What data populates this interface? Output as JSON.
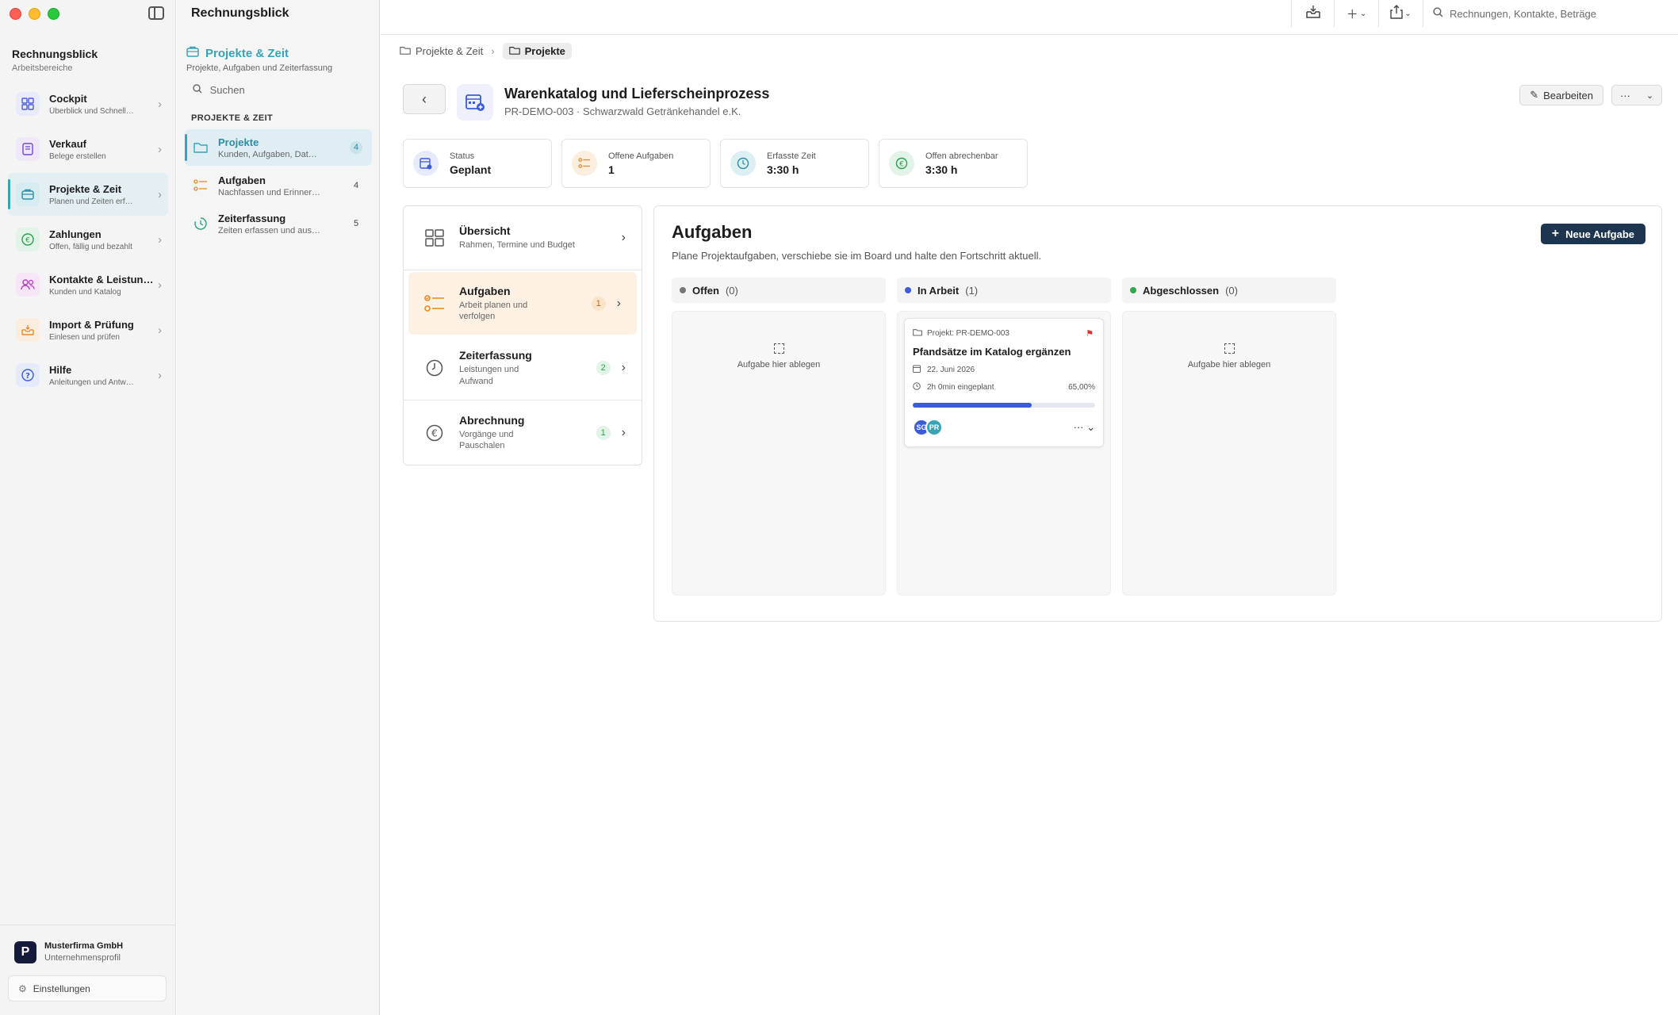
{
  "app": {
    "title": "Rechnungsblick"
  },
  "sidebar": {
    "title": "Rechnungsblick",
    "subtitle": "Arbeitsbereiche",
    "items": [
      {
        "label": "Cockpit",
        "desc": "Überblick und Schnellzu…",
        "icon": "grid-icon",
        "color": "#4b5bd8",
        "bg": "#e8ebfb"
      },
      {
        "label": "Verkauf",
        "desc": "Belege erstellen",
        "icon": "document-icon",
        "color": "#7048c8",
        "bg": "#efe8fb"
      },
      {
        "label": "Projekte & Zeit",
        "desc": "Planen und Zeiten erfass…",
        "icon": "briefcase-icon",
        "color": "#2b8fa3",
        "bg": "#d6ecf1"
      },
      {
        "label": "Zahlungen",
        "desc": "Offen, fällig und bezahlt",
        "icon": "euro-icon",
        "color": "#2e9e50",
        "bg": "#e2f4e7"
      },
      {
        "label": "Kontakte & Leistung…",
        "desc": "Kunden und Katalog",
        "icon": "people-icon",
        "color": "#b83ac2",
        "bg": "#f6e6f8"
      },
      {
        "label": "Import & Prüfung",
        "desc": "Einlesen und prüfen",
        "icon": "tray-icon",
        "color": "#e48a2a",
        "bg": "#fbeedf"
      },
      {
        "label": "Hilfe",
        "desc": "Anleitungen und Antwort…",
        "icon": "question-icon",
        "color": "#3b5bdb",
        "bg": "#e6ebfb"
      }
    ],
    "company": {
      "name": "Musterfirma GmbH",
      "sub": "Unternehmensprofil",
      "logo": "P"
    },
    "settings": "Einstellungen"
  },
  "column2": {
    "title": "Projekte & Zeit",
    "subtitle": "Projekte, Aufgaben und Zeiterfassung",
    "search_placeholder": "Suchen",
    "section": "PROJEKTE & ZEIT",
    "items": [
      {
        "label": "Projekte",
        "desc": "Kunden, Aufgaben, Dateien",
        "count": "4"
      },
      {
        "label": "Aufgaben",
        "desc": "Nachfassen und Erinneru…",
        "count": "4"
      },
      {
        "label": "Zeiterfassung",
        "desc": "Zeiten erfassen und ausw…",
        "count": "5"
      }
    ]
  },
  "toolbar": {
    "search_placeholder": "Rechnungen, Kontakte, Beträge"
  },
  "breadcrumb": {
    "parent": "Projekte & Zeit",
    "current": "Projekte"
  },
  "project": {
    "title": "Warenkatalog und Lieferscheinprozess",
    "subtitle": "PR-DEMO-003 · Schwarzwald Getränkehandel e.K.",
    "edit_label": "Bearbeiten",
    "more_label": "···"
  },
  "stats": [
    {
      "label": "Status",
      "value": "Geplant",
      "color": "#3b5bdb",
      "bg": "#e6ebfb"
    },
    {
      "label": "Offene Aufgaben",
      "value": "1",
      "color": "#e48a2a",
      "bg": "#fbeedf"
    },
    {
      "label": "Erfasste Zeit",
      "value": "3:30 h",
      "color": "#2b8fa3",
      "bg": "#dcf0f4"
    },
    {
      "label": "Offen abrechenbar",
      "value": "3:30 h",
      "color": "#2e9e50",
      "bg": "#e2f4e7"
    }
  ],
  "submenu": [
    {
      "label": "Übersicht",
      "desc": "Rahmen, Termine und Budget",
      "count": ""
    },
    {
      "label": "Aufgaben",
      "desc": "Arbeit planen und verfolgen",
      "count": "1"
    },
    {
      "label": "Zeiterfassung",
      "desc": "Leistungen und Aufwand",
      "count": "2"
    },
    {
      "label": "Abrechnung",
      "desc": "Vorgänge und Pauschalen",
      "count": "1"
    }
  ],
  "tasks": {
    "title": "Aufgaben",
    "subtitle": "Plane Projektaufgaben, verschiebe sie im Board und halte den Fortschritt aktuell.",
    "new_label": "Neue Aufgabe",
    "lanes": [
      {
        "name": "Offen",
        "count": "(0)",
        "color": "#777777",
        "empty": "Aufgabe hier ablegen"
      },
      {
        "name": "In Arbeit",
        "count": "(1)",
        "color": "#3b5bdb",
        "empty": ""
      },
      {
        "name": "Abgeschlossen",
        "count": "(0)",
        "color": "#2eaa4a",
        "empty": "Aufgabe hier ablegen"
      }
    ],
    "card": {
      "project": "Projekt: PR-DEMO-003",
      "title": "Pfandsätze im Katalog ergänzen",
      "date": "22. Juni 2026",
      "planned": "2h 0min eingeplant",
      "percent": "65,00%",
      "progress": 0.65,
      "avatars": [
        {
          "initials": "SG",
          "color": "#3b5bdb"
        },
        {
          "initials": "PR",
          "color": "#3aa2b5"
        }
      ]
    }
  }
}
